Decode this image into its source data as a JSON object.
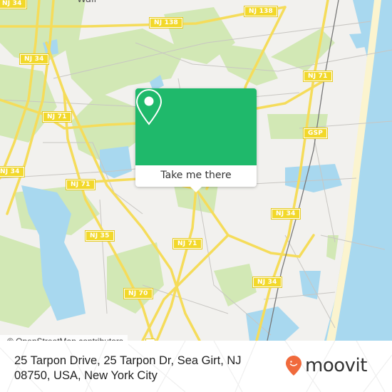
{
  "map": {
    "place_labels": [
      {
        "id": "wall",
        "text": "Wall"
      }
    ],
    "road_labels": [
      {
        "id": "nj34-top-left",
        "text": "NJ 34"
      },
      {
        "id": "nj138-left",
        "text": "NJ 138"
      },
      {
        "id": "nj138-right",
        "text": "NJ 138"
      },
      {
        "id": "nj34-upper",
        "text": "NJ 34"
      },
      {
        "id": "nj71-upper",
        "text": "NJ 71"
      },
      {
        "id": "nj71-middle",
        "text": "NJ 71"
      },
      {
        "id": "gsp",
        "text": "GSP"
      },
      {
        "id": "nj34-mid",
        "text": "NJ 34"
      },
      {
        "id": "nj71-lower",
        "text": "NJ 71"
      },
      {
        "id": "nj34-lower",
        "text": "NJ 34"
      },
      {
        "id": "nj35",
        "text": "NJ 35"
      },
      {
        "id": "nj71-bottom",
        "text": "NJ 71"
      },
      {
        "id": "nj34-bottom",
        "text": "NJ 34"
      },
      {
        "id": "nj70",
        "text": "NJ 70"
      }
    ],
    "attribution": "© OpenStreetMap contributors",
    "colors": {
      "land": "#f2f1ee",
      "park": "#d2e8b5",
      "water": "#a8d8ef",
      "road_major": "#f5dc5a",
      "beach": "#fbf4cf",
      "rail": "#777777"
    }
  },
  "popup": {
    "icon": "location-pin-icon",
    "button_label": "Take me there",
    "accent_color": "#1fb96b"
  },
  "footer": {
    "address": "25 Tarpon Drive, 25 Tarpon Dr, Sea Girt, NJ 08750, USA, New York City",
    "brand": "moovit",
    "brand_color": "#f06a3c"
  }
}
